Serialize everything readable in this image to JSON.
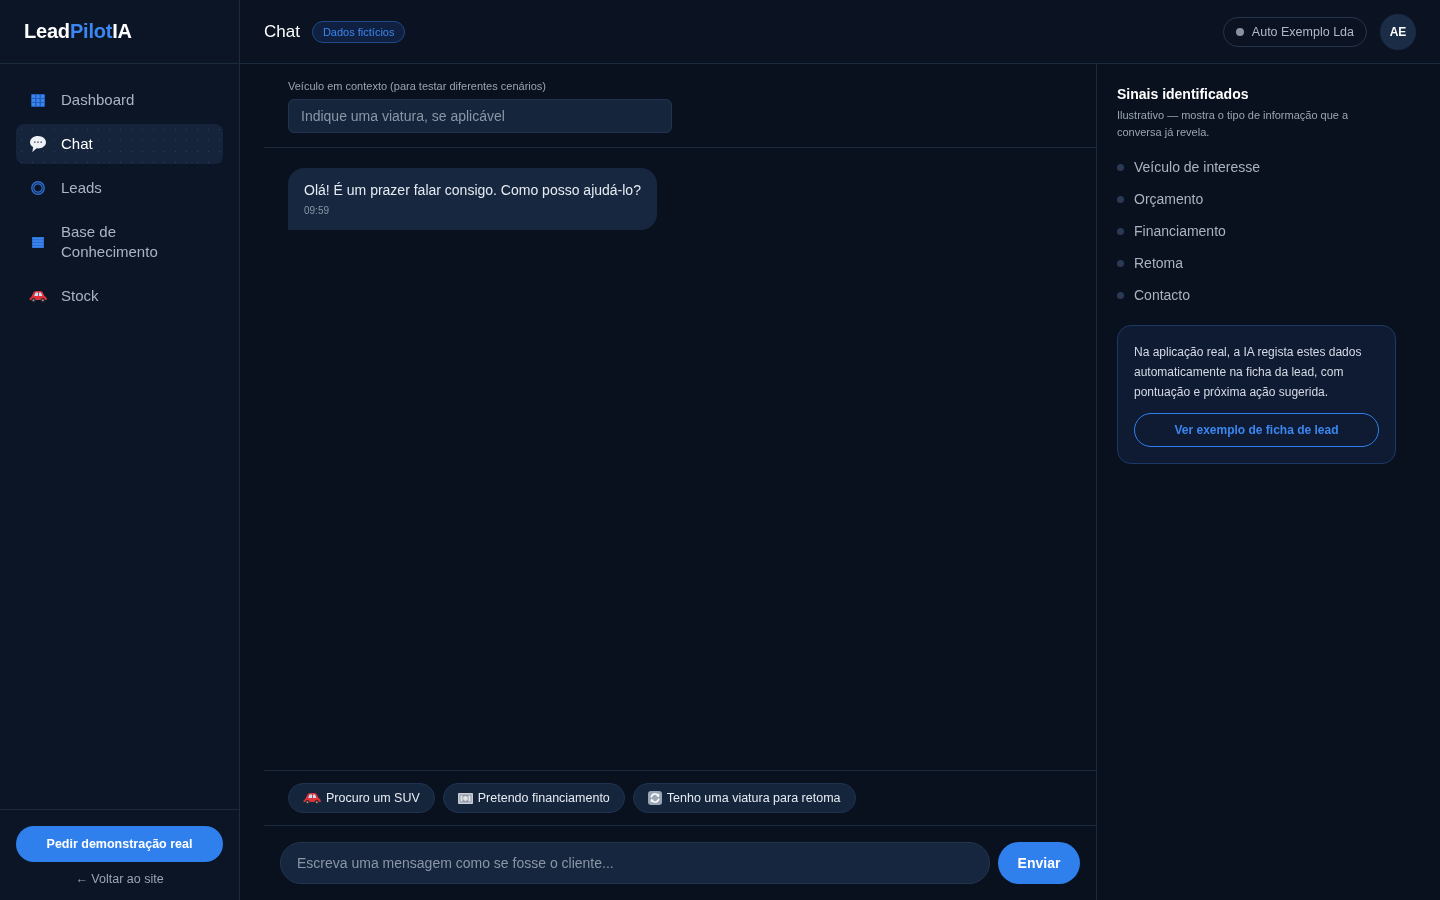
{
  "sidebar": {
    "logo_parts": [
      {
        "text": "Lead",
        "accent": false
      },
      {
        "text": "Pilot",
        "accent": true
      },
      {
        "text": "IA",
        "accent": false
      }
    ],
    "items": [
      {
        "label": "Dashboard",
        "selected": false
      },
      {
        "label": "Chat",
        "selected": true
      },
      {
        "label": "Leads",
        "selected": false
      },
      {
        "label": "Base de Conhecimento",
        "selected": false
      },
      {
        "label": "Stock",
        "selected": false
      }
    ],
    "demo_button": "Pedir demonstração real",
    "back_link": "← Voltar ao site"
  },
  "header": {
    "title": "Chat",
    "badge": "Dados fictícios",
    "company": "Auto Exemplo Lda",
    "avatar": "AE"
  },
  "chat": {
    "context_label": "Veículo em contexto (para testar diferentes cenários)",
    "context_field": {
      "placeholder": "Indique uma viatura, se aplicável"
    },
    "messages": [
      {
        "text": "Olá! É um prazer falar consigo. Como posso ajudá-lo?",
        "time": "09:59"
      }
    ],
    "quick_replies": [
      "Procuro um SUV",
      "Pretendo financiamento",
      "Tenho uma viatura para retoma"
    ],
    "composer": {
      "placeholder": "Escreva uma mensagem como se fosse o cliente..."
    },
    "send_button": "Enviar"
  },
  "signals": {
    "title": "Sinais identificados",
    "subtitle": "Ilustrativo — mostra o tipo de informação que a conversa já revela.",
    "items": [
      {
        "label": "Veículo de interesse",
        "identified": false
      },
      {
        "label": "Orçamento",
        "identified": false
      },
      {
        "label": "Financiamento",
        "identified": false
      },
      {
        "label": "Retoma",
        "identified": false
      },
      {
        "label": "Contacto",
        "identified": false
      }
    ],
    "note": "Na aplicação real, a IA regista estes dados automaticamente na ficha da lead, com pontuação e próxima ação sugerida.",
    "note_button": "Ver exemplo de ficha de lead"
  }
}
